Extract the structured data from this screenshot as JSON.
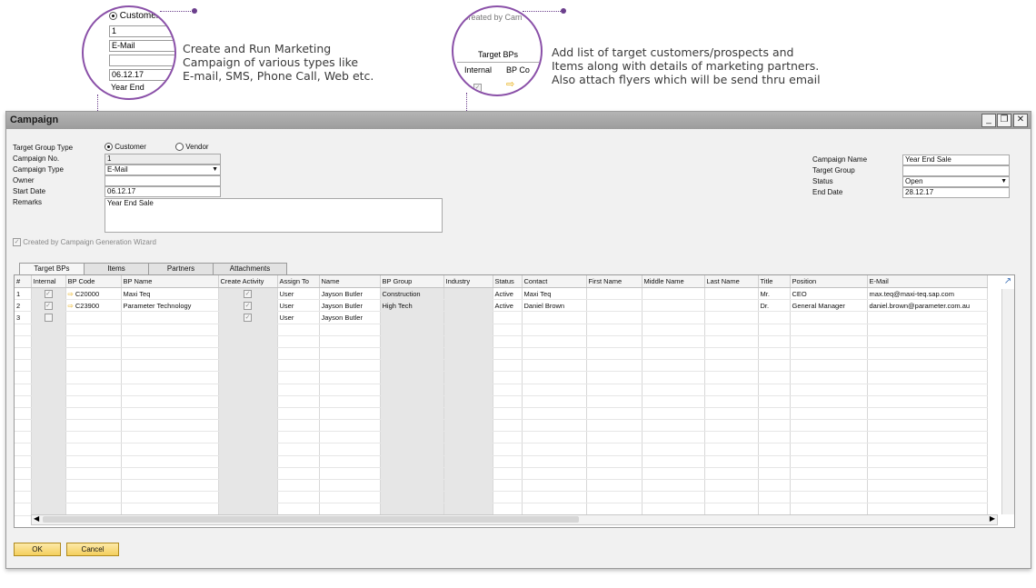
{
  "callouts": {
    "left": {
      "line1": "Create and Run Marketing",
      "line2": "Campaign of various types like",
      "line3": "E-mail, SMS, Phone Call, Web etc.",
      "lens": {
        "radio_label": "Customer",
        "f1": "1",
        "f2": "E-Mail",
        "f4": "06.12.17",
        "f5": "Year End"
      }
    },
    "right": {
      "line1": "Add list of target customers/prospects and",
      "line2": "Items along with details of marketing partners.",
      "line3": "Also attach flyers which will be send thru email",
      "lens": {
        "created_text": "Created by Cam",
        "tab": "Target BPs",
        "col1": "Internal",
        "col2": "BP Co"
      }
    }
  },
  "window": {
    "title": "Campaign",
    "controls": [
      "_",
      "❐",
      "✕"
    ],
    "form": {
      "target_group_type_label": "Target Group Type",
      "customer_label": "Customer",
      "vendor_label": "Vendor",
      "campaign_no_label": "Campaign No.",
      "campaign_no": "1",
      "campaign_type_label": "Campaign Type",
      "campaign_type": "E-Mail",
      "owner_label": "Owner",
      "owner": "",
      "start_date_label": "Start Date",
      "start_date": "06.12.17",
      "remarks_label": "Remarks",
      "remarks": "Year End Sale",
      "wizard_label": "Created by Campaign Generation Wizard",
      "campaign_name_label": "Campaign Name",
      "campaign_name": "Year End Sale",
      "target_group_label": "Target Group",
      "target_group": "",
      "status_label": "Status",
      "status": "Open",
      "end_date_label": "End Date",
      "end_date": "28.12.17"
    },
    "tabs": [
      "Target BPs",
      "Items",
      "Partners",
      "Attachments"
    ],
    "grid": {
      "columns": [
        "#",
        "Internal",
        "BP Code",
        "BP Name",
        "Create Activity",
        "Assign To",
        "Name",
        "BP Group",
        "Industry",
        "Status",
        "Contact",
        "First Name",
        "Middle Name",
        "Last Name",
        "Title",
        "Position",
        "E-Mail"
      ],
      "rows": [
        {
          "n": "1",
          "bp_code": "C20000",
          "bp_name": "Maxi Teq",
          "assign_to": "User",
          "name": "Jayson Butler",
          "bp_group": "Construction",
          "status": "Active",
          "contact": "Maxi Teq",
          "title": "Mr.",
          "position": "CEO",
          "email": "max.teq@maxi-teq.sap.com"
        },
        {
          "n": "2",
          "bp_code": "C23900",
          "bp_name": "Parameter Technology",
          "assign_to": "User",
          "name": "Jayson Butler",
          "bp_group": "High Tech",
          "status": "Active",
          "contact": "Daniel Brown",
          "title": "Dr.",
          "position": "General Manager",
          "email": "daniel.brown@parameter.com.au"
        },
        {
          "n": "3",
          "bp_code": "",
          "bp_name": "",
          "assign_to": "User",
          "name": "Jayson Butler",
          "bp_group": "",
          "status": "",
          "contact": "",
          "title": "",
          "position": "",
          "email": ""
        }
      ]
    },
    "buttons": {
      "ok": "OK",
      "cancel": "Cancel"
    }
  },
  "colors": {
    "accent": "#6b3e8c",
    "button": "#f4cf5d",
    "titlebar": "#a8a8a8"
  }
}
